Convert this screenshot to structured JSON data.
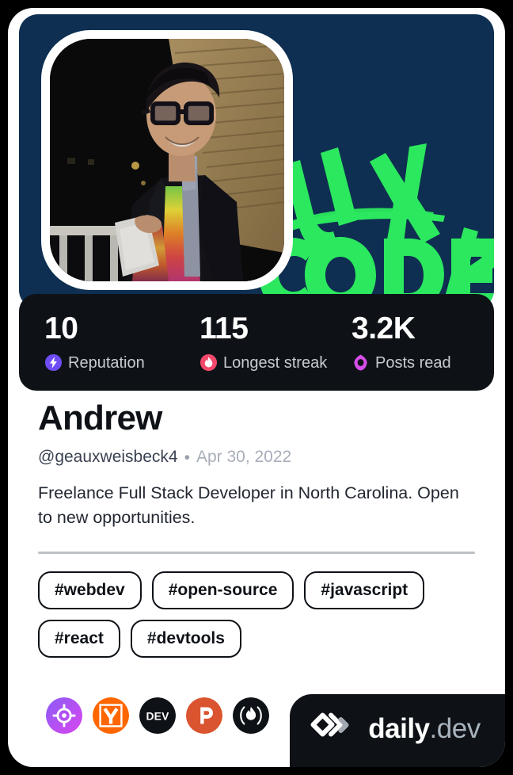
{
  "card": {
    "background_color": "#ffffff",
    "page_background": "#000000"
  },
  "cover": {
    "background_color": "#0E2F51",
    "art_color": "#2BE85E",
    "art_text_top": "UX",
    "art_text_bottom": "<CODE/>"
  },
  "avatar": {
    "alt": "Andrew smiling, wearing glasses, a tie-dye shirt, gray tie and dark blazer"
  },
  "stats": [
    {
      "value": "10",
      "label": "Reputation",
      "icon": "reputation-bolt-icon",
      "color": "#6E4DF6"
    },
    {
      "value": "115",
      "label": "Longest streak",
      "icon": "streak-flame-icon",
      "color": "#F5496C"
    },
    {
      "value": "3.2K",
      "label": "Posts read",
      "icon": "posts-read-eye-icon",
      "color": "#D74DE8"
    }
  ],
  "profile": {
    "name": "Andrew",
    "handle": "@geauxweisbeck4",
    "separator": "•",
    "joined": "Apr 30, 2022",
    "bio": "Freelance Full Stack Developer in North Carolina. Open to new opportunities."
  },
  "tags": [
    "#webdev",
    "#open-source",
    "#javascript",
    "#react",
    "#devtools"
  ],
  "socials": [
    {
      "name": "roadmap-target-icon",
      "color": "#A855F7"
    },
    {
      "name": "hackernews-icon",
      "color": "#FF6600"
    },
    {
      "name": "dev-to-icon",
      "color": "#0E1217"
    },
    {
      "name": "product-hunt-icon",
      "color": "#DA552F"
    },
    {
      "name": "codewars-flame-icon",
      "color": "#0E1217"
    }
  ],
  "brand": {
    "name_primary": "daily",
    "name_secondary": ".dev",
    "background_color": "#0E1217"
  }
}
